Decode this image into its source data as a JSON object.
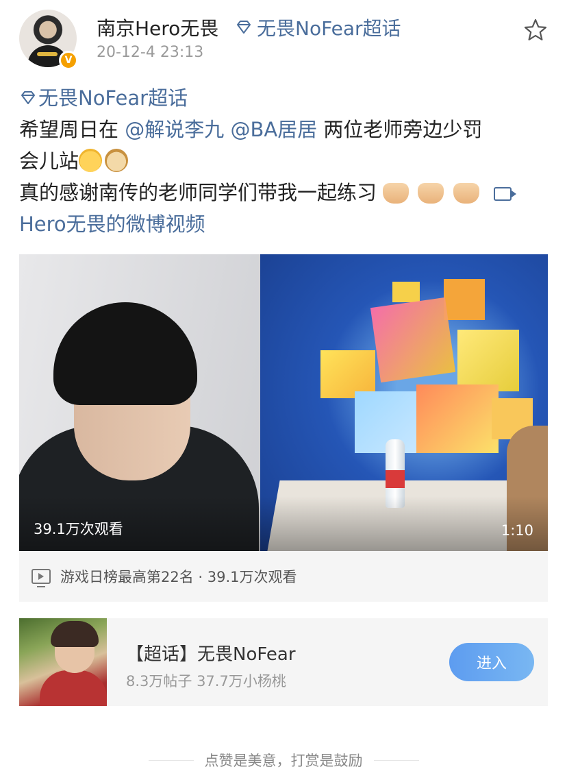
{
  "header": {
    "username": "南京Hero无畏",
    "topic_tag": "无畏NoFear超话",
    "timestamp": "20-12-4 23:13",
    "verified_badge": "V"
  },
  "post": {
    "topic_tag": "无畏NoFear超话",
    "line1_prefix": "希望周日在",
    "mention1": "@解说李九",
    "mention2": "@BA居居",
    "line1_suffix": "两位老师旁边少罚",
    "line2": "会儿站",
    "line3": "真的感谢南传的老师同学们带我一起练习",
    "video_link": "Hero无畏的微博视频"
  },
  "video": {
    "views_overlay": "39.1万次观看",
    "duration": "1:10"
  },
  "video_info": {
    "text": "游戏日榜最高第22名 · 39.1万次观看"
  },
  "supertopic_card": {
    "title": "【超话】无畏NoFear",
    "stats": "8.3万帖子 37.7万小杨桃",
    "enter_label": "进入"
  },
  "footer": {
    "text": "点赞是美意，打赏是鼓励"
  },
  "colors": {
    "link": "#4a6d9b",
    "button_gradient_start": "#5d9cf0",
    "button_gradient_end": "#79b7f2",
    "verified": "#f5a000"
  }
}
